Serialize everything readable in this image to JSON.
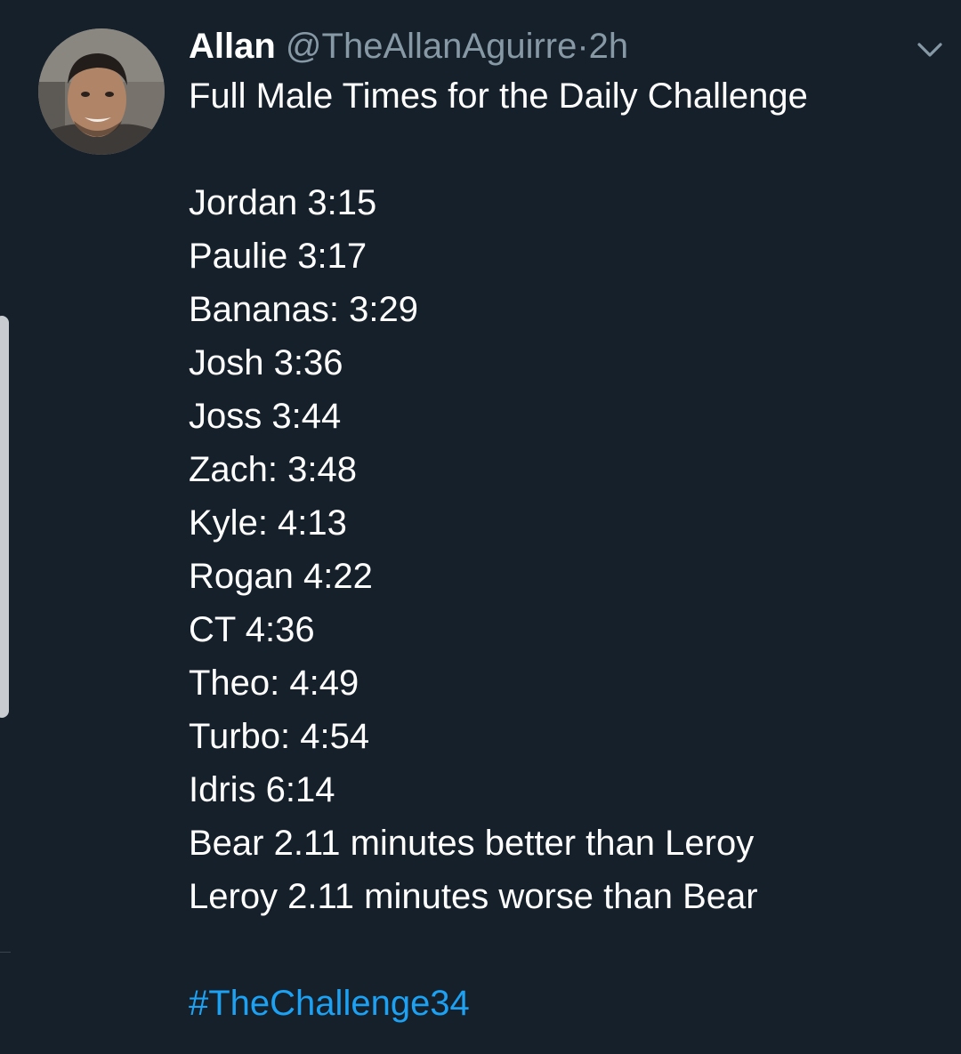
{
  "tweet": {
    "author_name": "Allan",
    "handle": "@TheAllanAguirre",
    "separator": "·",
    "timestamp": "2h",
    "intro": "Full Male Times for the Daily Challenge",
    "lines": [
      "Jordan 3:15",
      "Paulie 3:17",
      "Bananas: 3:29",
      "Josh 3:36",
      "Joss 3:44",
      "Zach: 3:48",
      "Kyle: 4:13",
      "Rogan 4:22",
      "CT 4:36",
      "Theo: 4:49",
      "Turbo: 4:54",
      "Idris 6:14",
      "Bear 2.11 minutes better than Leroy",
      "Leroy 2.11 minutes worse than Bear"
    ],
    "hashtag": "#TheChallenge34"
  },
  "icons": {
    "menu": "chevron-down-icon",
    "avatar": "avatar"
  },
  "colors": {
    "background": "#15202b",
    "primary_text": "#ffffff",
    "secondary_text": "#8899a6",
    "link": "#1da1f2"
  }
}
